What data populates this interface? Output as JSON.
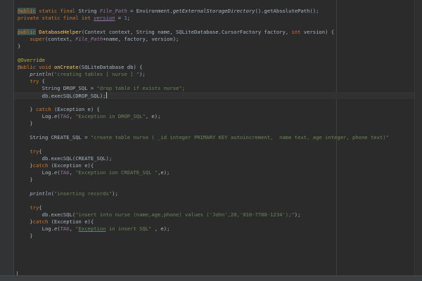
{
  "editor": {
    "theme": {
      "background": "#2b2b2b",
      "keyword": "#cc7832",
      "string": "#6a8759",
      "field": "#9876aa",
      "number": "#6897bb",
      "annotation": "#bbb529",
      "method": "#ffc66d",
      "text": "#a9b7c6"
    },
    "current_line": 14,
    "lines": [
      [
        [
          "kw sel",
          "public"
        ],
        [
          "kw",
          " static final "
        ],
        [
          "",
          "String "
        ],
        [
          "fld",
          "File_Path"
        ],
        [
          "",
          " = Environment."
        ],
        [
          "it",
          "getExternalStorageDirectory"
        ],
        [
          "",
          "().getAbsolutePath();"
        ]
      ],
      [
        [
          "kw",
          "private static final int "
        ],
        [
          "fld ul",
          "version"
        ],
        [
          "",
          " = "
        ],
        [
          "num",
          "1"
        ],
        [
          "",
          ";"
        ]
      ],
      [],
      [
        [
          "kw sel",
          "public"
        ],
        [
          "",
          " "
        ],
        [
          "mth",
          "DatabaseHelper"
        ],
        [
          "",
          "(Context context, String name, SQLiteDatabase.CursorFactory factory, "
        ],
        [
          "kw",
          "int "
        ],
        [
          "",
          "version) {"
        ]
      ],
      [
        [
          "",
          "    "
        ],
        [
          "kw",
          "super"
        ],
        [
          "",
          "(context, "
        ],
        [
          "fld",
          "File_Path"
        ],
        [
          "",
          "+name, factory, version);"
        ]
      ],
      [
        [
          "",
          "}"
        ]
      ],
      [],
      [
        [
          "ann",
          "@Override"
        ]
      ],
      [
        [
          "kw",
          "public void "
        ],
        [
          "mth",
          "onCreate"
        ],
        [
          "",
          "(SQLiteDatabase db) {"
        ]
      ],
      [
        [
          "",
          "    "
        ],
        [
          "it",
          "println"
        ],
        [
          "",
          "("
        ],
        [
          "str",
          "\"creating tables [ nurse ] \""
        ],
        [
          "",
          ");"
        ]
      ],
      [
        [
          "",
          "    "
        ],
        [
          "kw",
          "try "
        ],
        [
          "",
          "{"
        ]
      ],
      [
        [
          "",
          "        String DROP_SQL = "
        ],
        [
          "str",
          "\"drop table if exists nurse\""
        ],
        [
          "kw",
          ";"
        ]
      ],
      [
        [
          "",
          "        db.execSQL(DROP_SQL);"
        ]
      ],
      [],
      [
        [
          "",
          "    } "
        ],
        [
          "kw",
          "catch "
        ],
        [
          "",
          "(Exception e) {"
        ]
      ],
      [
        [
          "",
          "        Log."
        ],
        [
          "it",
          "e"
        ],
        [
          "",
          "("
        ],
        [
          "fld",
          "TAG"
        ],
        [
          "",
          ", "
        ],
        [
          "str",
          "\"Exception in DROP_SQL\""
        ],
        [
          "",
          ", e);"
        ]
      ],
      [
        [
          "",
          "    }"
        ]
      ],
      [],
      [
        [
          "",
          "    String CREATE_SQL = "
        ],
        [
          "str",
          "\"create table nurse ( _id integer PRIMARY KEY autoincrement,  name text, age integer, phone text)\""
        ]
      ],
      [],
      [
        [
          "",
          "    "
        ],
        [
          "kw",
          "try"
        ],
        [
          "",
          "{"
        ]
      ],
      [
        [
          "",
          "        db.execSQL(CREATE_SQL);"
        ]
      ],
      [
        [
          "",
          "    }"
        ],
        [
          "kw",
          "catch "
        ],
        [
          "",
          "(Exception e){"
        ]
      ],
      [
        [
          "",
          "        Log."
        ],
        [
          "it",
          "e"
        ],
        [
          "",
          "("
        ],
        [
          "fld",
          "TAG"
        ],
        [
          "",
          ", "
        ],
        [
          "str",
          "\"Exception ion CREATE_SQL \""
        ],
        [
          "",
          ",e);"
        ]
      ],
      [
        [
          "",
          "    }"
        ]
      ],
      [],
      [
        [
          "",
          "    "
        ],
        [
          "it",
          "println"
        ],
        [
          "",
          "("
        ],
        [
          "str",
          "\"inserting records\""
        ],
        [
          "",
          ");"
        ]
      ],
      [],
      [
        [
          "",
          "    "
        ],
        [
          "kw",
          "try"
        ],
        [
          "",
          "{"
        ]
      ],
      [
        [
          "",
          "        db.execSQL("
        ],
        [
          "str",
          "\"insert into nurse (name,age,phone) values ('John',20,'010-7788-1234');\""
        ],
        [
          "",
          ");"
        ]
      ],
      [
        [
          "",
          "    }"
        ],
        [
          "kw",
          "catch "
        ],
        [
          "",
          "(Exception e){"
        ]
      ],
      [
        [
          "",
          "        Log."
        ],
        [
          "it",
          "e"
        ],
        [
          "",
          "("
        ],
        [
          "fld",
          "TAG"
        ],
        [
          "",
          ", "
        ],
        [
          "str",
          "\""
        ],
        [
          "str ul",
          "Exception"
        ],
        [
          "str",
          " in insert SQL\""
        ],
        [
          "",
          " , e);"
        ]
      ],
      [
        [
          "",
          "    }"
        ]
      ],
      [],
      [],
      [],
      [],
      []
    ]
  }
}
